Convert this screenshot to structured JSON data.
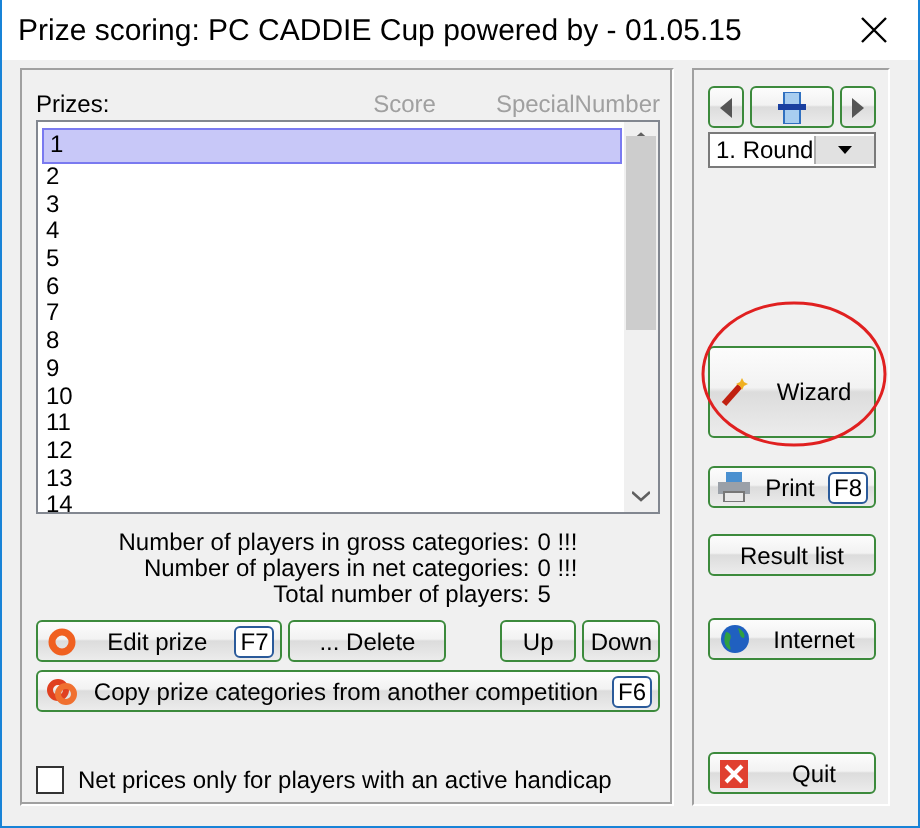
{
  "window": {
    "title": "Prize scoring: PC CADDIE Cup powered by - 01.05.15"
  },
  "prizes": {
    "label": "Prizes:",
    "columns": [
      "Score",
      "SpecialNumber"
    ],
    "rows": [
      {
        "label": "1",
        "selected": true
      },
      {
        "label": "2",
        "selected": false
      },
      {
        "label": "3",
        "selected": false
      },
      {
        "label": "4",
        "selected": false
      },
      {
        "label": "5",
        "selected": false
      },
      {
        "label": "6",
        "selected": false
      },
      {
        "label": "7",
        "selected": false
      },
      {
        "label": "8",
        "selected": false
      },
      {
        "label": "9",
        "selected": false
      },
      {
        "label": "10",
        "selected": false
      },
      {
        "label": "11",
        "selected": false
      },
      {
        "label": "12",
        "selected": false
      },
      {
        "label": "13",
        "selected": false
      },
      {
        "label": "14",
        "selected": false
      }
    ]
  },
  "stats": [
    {
      "label": "Number of players in gross categories:",
      "value": "0 !!!"
    },
    {
      "label": "Number of players in net categories:",
      "value": "0 !!!"
    },
    {
      "label": "Total number of players:",
      "value": "5"
    }
  ],
  "left_buttons": [
    {
      "kind": "edit",
      "label": "Edit prize",
      "key": "F7"
    },
    {
      "kind": "plain",
      "label": "... Delete"
    },
    {
      "kind": "plain",
      "label": "Up"
    },
    {
      "kind": "plain",
      "label": "Down"
    },
    {
      "kind": "copy",
      "label": "Copy prize categories from another competition",
      "key": "F6"
    }
  ],
  "net_only": {
    "label": "Net prices only for players with an active handicap",
    "checked": false
  },
  "round": {
    "value": "1. Round"
  },
  "right_buttons": [
    {
      "kind": "wizard",
      "label": "Wizard",
      "highlighted": true
    },
    {
      "kind": "print",
      "label": "Print",
      "key": "F8",
      "highlighted": false
    },
    {
      "kind": "plain",
      "label": "Result list",
      "highlighted": false
    },
    {
      "kind": "internet",
      "label": "Internet",
      "highlighted": false
    },
    {
      "kind": "quit",
      "label": "Quit",
      "highlighted": false
    }
  ]
}
